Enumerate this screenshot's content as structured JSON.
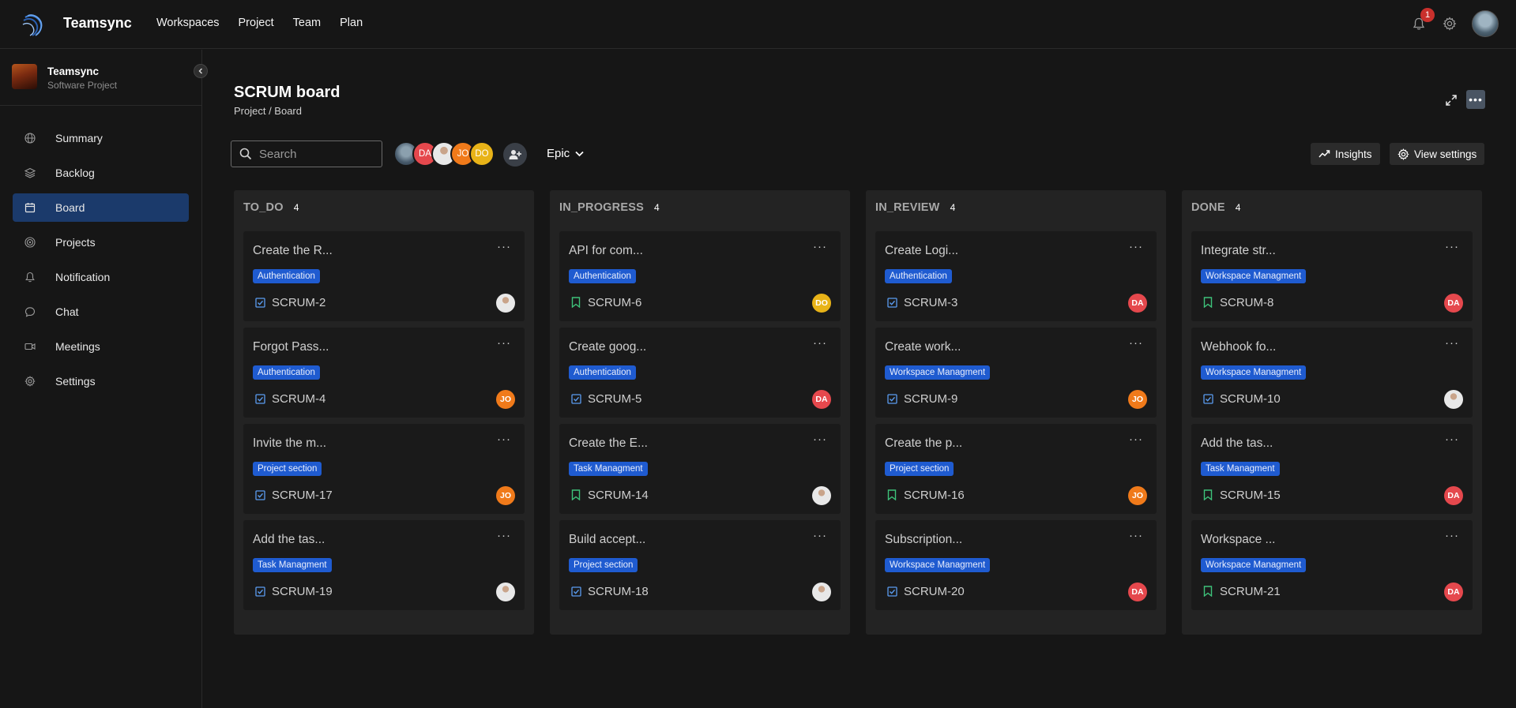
{
  "app": {
    "name": "Teamsync"
  },
  "topnav": [
    "Workspaces",
    "Project",
    "Team",
    "Plan"
  ],
  "notifications": {
    "count": "1"
  },
  "project": {
    "name": "Teamsync",
    "type": "Software Project"
  },
  "sidebar": {
    "items": [
      {
        "label": "Summary",
        "icon": "globe-icon",
        "active": false
      },
      {
        "label": "Backlog",
        "icon": "layers-icon",
        "active": false
      },
      {
        "label": "Board",
        "icon": "calendar-icon",
        "active": true
      },
      {
        "label": "Projects",
        "icon": "target-icon",
        "active": false
      },
      {
        "label": "Notification",
        "icon": "bell-icon",
        "active": false
      },
      {
        "label": "Chat",
        "icon": "chat-icon",
        "active": false
      },
      {
        "label": "Meetings",
        "icon": "video-icon",
        "active": false
      },
      {
        "label": "Settings",
        "icon": "gear-icon",
        "active": false
      }
    ]
  },
  "board": {
    "title": "SCRUM board",
    "breadcrumb": "Project / Board"
  },
  "toolbar": {
    "search_placeholder": "Search",
    "avatars": [
      {
        "initials": "",
        "kind": "photo1"
      },
      {
        "initials": "DA",
        "kind": "da"
      },
      {
        "initials": "",
        "kind": "photo2"
      },
      {
        "initials": "JO",
        "kind": "jo"
      },
      {
        "initials": "DO",
        "kind": "do"
      }
    ],
    "epic_label": "Epic",
    "insights_label": "Insights",
    "view_settings_label": "View settings"
  },
  "colors": {
    "tag": "#1f5bd0",
    "active_nav": "#1b3a6b",
    "DA": "#e5484d",
    "JO": "#f07a1a",
    "DO": "#e8b318"
  },
  "columns": [
    {
      "title": "TO_DO",
      "count": "4",
      "cards": [
        {
          "title": "Create the R...",
          "tag": "Authentication",
          "key": "SCRUM-2",
          "type": "task",
          "assignee": "photo"
        },
        {
          "title": "Forgot Pass...",
          "tag": "Authentication",
          "key": "SCRUM-4",
          "type": "task",
          "assignee": "JO"
        },
        {
          "title": "Invite the m...",
          "tag": "Project section",
          "key": "SCRUM-17",
          "type": "task",
          "assignee": "JO"
        },
        {
          "title": "Add the tas...",
          "tag": "Task Managment",
          "key": "SCRUM-19",
          "type": "task",
          "assignee": "photo"
        }
      ]
    },
    {
      "title": "IN_PROGRESS",
      "count": "4",
      "cards": [
        {
          "title": "API for com...",
          "tag": "Authentication",
          "key": "SCRUM-6",
          "type": "story",
          "assignee": "DO"
        },
        {
          "title": "Create goog...",
          "tag": "Authentication",
          "key": "SCRUM-5",
          "type": "task",
          "assignee": "DA"
        },
        {
          "title": "Create the E...",
          "tag": "Task Managment",
          "key": "SCRUM-14",
          "type": "story",
          "assignee": "photo"
        },
        {
          "title": "Build accept...",
          "tag": "Project section",
          "key": "SCRUM-18",
          "type": "task",
          "assignee": "photo"
        }
      ]
    },
    {
      "title": "IN_REVIEW",
      "count": "4",
      "cards": [
        {
          "title": "Create Logi...",
          "tag": "Authentication",
          "key": "SCRUM-3",
          "type": "task",
          "assignee": "DA"
        },
        {
          "title": "Create work...",
          "tag": "Workspace Managment",
          "key": "SCRUM-9",
          "type": "task",
          "assignee": "JO"
        },
        {
          "title": "Create the p...",
          "tag": "Project section",
          "key": "SCRUM-16",
          "type": "story",
          "assignee": "JO"
        },
        {
          "title": "Subscription...",
          "tag": "Workspace Managment",
          "key": "SCRUM-20",
          "type": "task",
          "assignee": "DA"
        }
      ]
    },
    {
      "title": "DONE",
      "count": "4",
      "cards": [
        {
          "title": "Integrate str...",
          "tag": "Workspace Managment",
          "key": "SCRUM-8",
          "type": "story",
          "assignee": "DA"
        },
        {
          "title": "Webhook fo...",
          "tag": "Workspace Managment",
          "key": "SCRUM-10",
          "type": "task",
          "assignee": "photo"
        },
        {
          "title": "Add the tas...",
          "tag": "Task Managment",
          "key": "SCRUM-15",
          "type": "story",
          "assignee": "DA"
        },
        {
          "title": "Workspace ...",
          "tag": "Workspace Managment",
          "key": "SCRUM-21",
          "type": "story",
          "assignee": "DA"
        }
      ]
    }
  ]
}
